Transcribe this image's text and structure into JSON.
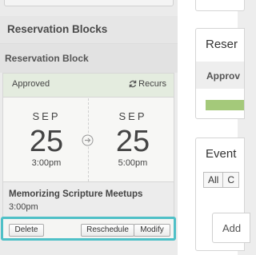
{
  "left": {
    "section_title": "Reservation Blocks",
    "block_title": "Reservation Block",
    "card": {
      "status": "Approved",
      "recurs_label": "Recurs",
      "start": {
        "month": "SEP",
        "day": "25",
        "time": "3:00pm"
      },
      "end": {
        "month": "SEP",
        "day": "25",
        "time": "5:00pm"
      },
      "event_name": "Memorizing Scripture Meetups",
      "event_time": "3:00pm"
    },
    "actions": {
      "delete_label": "Delete",
      "reschedule_label": "Reschedule",
      "modify_label": "Modify"
    }
  },
  "right": {
    "card1": {
      "title": "Reser",
      "subheader": "Approv",
      "progress_color": "#a4c97a"
    },
    "card2": {
      "title": "Event",
      "tabs": [
        "All",
        "C"
      ],
      "input_text": "Add"
    }
  },
  "colors": {
    "highlight": "#4fc0c7",
    "approved_bg": "#e4ecdf"
  }
}
